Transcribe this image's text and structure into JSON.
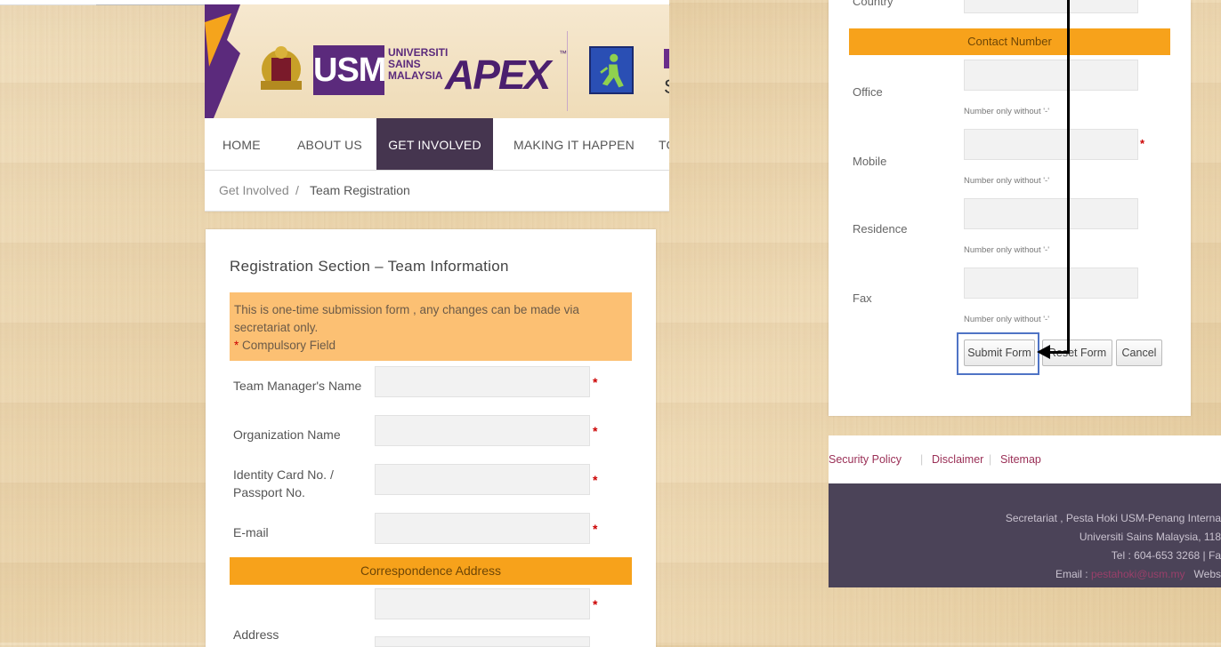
{
  "header": {
    "university_lines": [
      "UNIVERSITI",
      "SAINS",
      "MALAYSIA"
    ],
    "usm_text": "USM",
    "apex_text": "APEX",
    "apex_tm": "™",
    "clip_char": "S"
  },
  "nav": {
    "items": [
      {
        "label": "HOME"
      },
      {
        "label": "ABOUT US"
      },
      {
        "label": "GET INVOLVED"
      },
      {
        "label": "MAKING IT HAPPEN"
      },
      {
        "label": "TO"
      }
    ],
    "active": "GET INVOLVED"
  },
  "breadcrumb": {
    "parent": "Get Involved",
    "separator": "/",
    "current": "Team Registration"
  },
  "form": {
    "section_title": "Registration Section – Team Information",
    "notice_line1": "This is one-time submission form , any changes can be made via",
    "notice_line2": "secretariat only.",
    "required_star": "*",
    "compulsory_label": "Compulsory Field",
    "fields": [
      {
        "label": "Team Manager's Name",
        "value": ""
      },
      {
        "label": "Organization Name",
        "value": ""
      },
      {
        "label_line1": "Identity Card No. /",
        "label_line2": "Passport No.",
        "value": ""
      },
      {
        "label": "E-mail",
        "value": ""
      }
    ],
    "correspondence_header": "Correspondence Address",
    "address_label": "Address"
  },
  "contact": {
    "country_label": "Country",
    "header": "Contact Number",
    "hint": "Number only without '-'",
    "fields": [
      {
        "label": "Office",
        "value": ""
      },
      {
        "label": "Mobile",
        "value": ""
      },
      {
        "label": "Residence",
        "value": ""
      },
      {
        "label": "Fax",
        "value": ""
      }
    ]
  },
  "buttons": {
    "submit": "Submit Form",
    "reset": "Reset Form",
    "cancel": "Cancel"
  },
  "footer": {
    "links": [
      "Security Policy",
      "Disclaimer",
      "Sitemap"
    ],
    "separator": "|",
    "line1": "Secretariat , Pesta Hoki USM-Penang Interna",
    "line2": "Universiti Sains Malaysia, 118",
    "line3": "Tel : 604-653 3268  |  Fa",
    "email_label": "Email : ",
    "email": "pestahoki@usm.my",
    "web_label": "Webs"
  },
  "colors": {
    "accent_orange": "#f7a21b",
    "notice_bg": "#fcc073",
    "nav_active": "#45354f",
    "footer_bg": "#4b4358",
    "link": "#9a2f56",
    "highlight": "#4f74c5"
  }
}
